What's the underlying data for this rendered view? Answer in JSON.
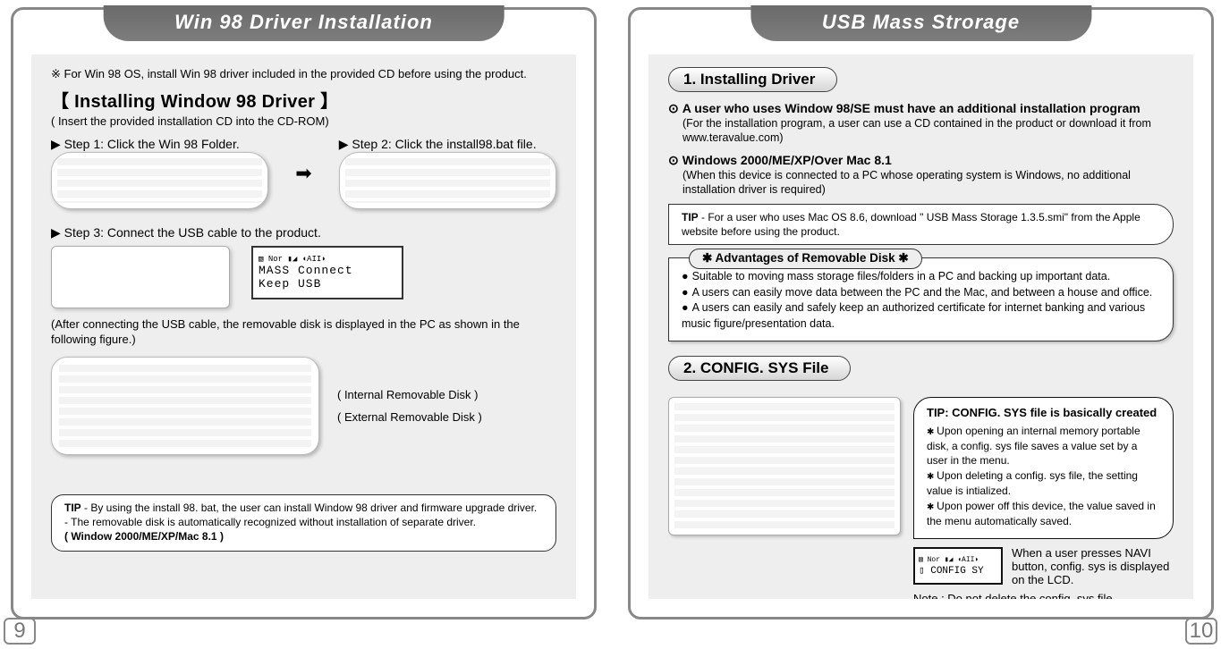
{
  "left": {
    "title": "Win 98 Driver Installation",
    "topNote": "※  For Win 98 OS, install Win 98 driver included in the provided CD before using the product.",
    "heading": "【 Installing Window  98 Driver 】",
    "subParen": "( Insert the provided installation CD into the CD-ROM)",
    "step1": "Step 1: Click the Win 98 Folder.",
    "step2": "Step 2: Click the install98.bat file.",
    "step3": "Step 3: Connect the USB cable to the product.",
    "lcdTop": "▧  Nor  ▮◢  ◖AII◗",
    "lcdLine1": "MASS Connect",
    "lcdLine2": "Keep USB",
    "afterText": "(After connecting the USB cable, the removable disk is displayed in the PC as shown in the following figure.)",
    "diskInternal": "( Internal Removable Disk )",
    "diskExternal": "( External Removable Disk )",
    "tip": {
      "lead": "TIP",
      "l1": " - By using the install 98. bat, the user can install Window 98 driver and firmware upgrade driver.",
      "l2": "      - The removable disk is automatically recognized without installation of separate driver.",
      "l3": "        ( Window 2000/ME/XP/Mac 8.1 )"
    },
    "pageNumber": "9"
  },
  "right": {
    "title": "USB Mass Strorage",
    "section1": "1. Installing Driver",
    "p1Title": "A user who uses Window 98/SE must have an additional installation program",
    "p1Sub": "(For the installation program, a user can use a CD contained in the product or download it from  www.teravalue.com)",
    "p2Title": "Windows 2000/ME/XP/Over Mac 8.1",
    "p2Sub": "(When this device is connected to a PC whose operating system is Windows, no additional  installation driver is required)",
    "tipMac": {
      "lead": "TIP",
      "text": " - For a user who uses Mac OS 8.6, download \" USB Mass Storage 1.3.5.smi\" from the Apple website before using the product."
    },
    "advTitle": "✱ Advantages of Removable Disk ✱",
    "adv1": "Suitable to moving mass storage files/folders in a PC and backing up important data.",
    "adv2": "A users can easily move data between the PC and the Mac, and between a house and office.",
    "adv3": "A users can easily and safely keep an authorized certificate for internet banking and various music figure/presentation data.",
    "section2": "2. CONFIG. SYS File",
    "configTip": {
      "title": "TIP: CONFIG. SYS file is basically created",
      "b1": "Upon opening an internal memory portable disk, a config. sys file saves a value set by a user in the menu.",
      "b2": "Upon deleting a config. sys file, the setting value is intialized.",
      "b3": "Upon power off this device, the value saved in the menu automatically saved."
    },
    "lcdSmallTop": "▧ Nor ▮◢ ◖AII◗",
    "lcdSmallLine": "▯ CONFIG SY",
    "naviText": "When a user presses NAVI button, config. sys is displayed on the LCD.",
    "noteBottom": "Note : Do not delete the config. sys file.",
    "pageNumber": "10"
  }
}
